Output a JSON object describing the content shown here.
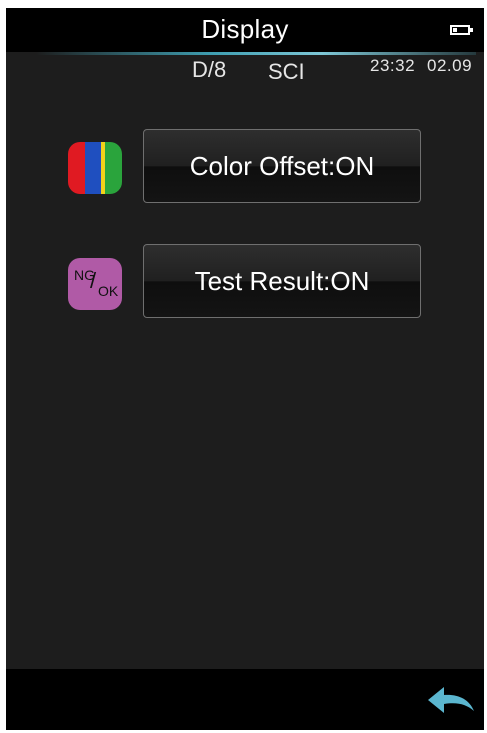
{
  "header": {
    "title": "Display",
    "battery_icon": "battery-icon"
  },
  "status": {
    "geometry": "D/8",
    "mode": "SCI",
    "time": "23:32",
    "date": "02.09"
  },
  "settings": [
    {
      "label": "Color Offset:ON",
      "icon": "color-offset-icon",
      "icon_colors": [
        "#e01a22",
        "#1f4fbf",
        "#f2d21a",
        "#2aa43c"
      ]
    },
    {
      "label": "Test Result:ON",
      "icon": "ng-ok-icon",
      "icon_text_ng": "NG",
      "icon_text_slash": "/",
      "icon_text_ok": "OK",
      "icon_color": "#b05aa6"
    }
  ],
  "footer": {
    "back_icon": "back-arrow-icon",
    "accent_color": "#5bb6cf"
  }
}
